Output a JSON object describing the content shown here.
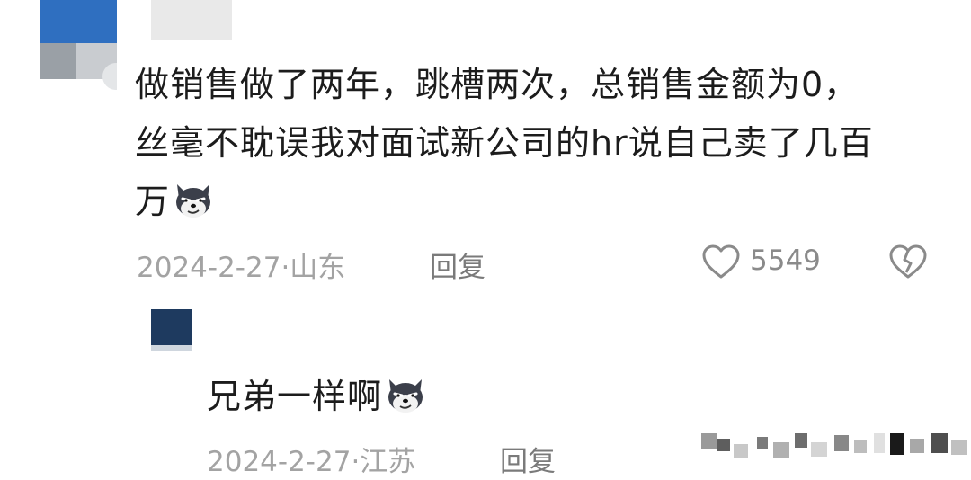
{
  "comment": {
    "text_line1": "做销售做了两年，跳槽两次，总销售金额为0，",
    "text_line2": "丝毫不耽误我对面试新公司的hr说自己卖了几百",
    "text_line3": "万",
    "emoji": "smirking-wolf-emoji",
    "date": "2024-2-27",
    "separator": "·",
    "location": "山东",
    "reply_label": "回复",
    "like_count": "5549"
  },
  "reply": {
    "text": "兄弟一样啊",
    "emoji": "smirking-wolf-emoji",
    "date": "2024-2-27",
    "separator": "·",
    "location": "江苏",
    "reply_label": "回复"
  },
  "icons": {
    "like": "heart-outline-icon",
    "dislike": "broken-heart-icon"
  },
  "colors": {
    "primary_text": "#1c1c1c",
    "meta_text": "#a3a3a3",
    "icon_gray": "#8a8a8a"
  }
}
